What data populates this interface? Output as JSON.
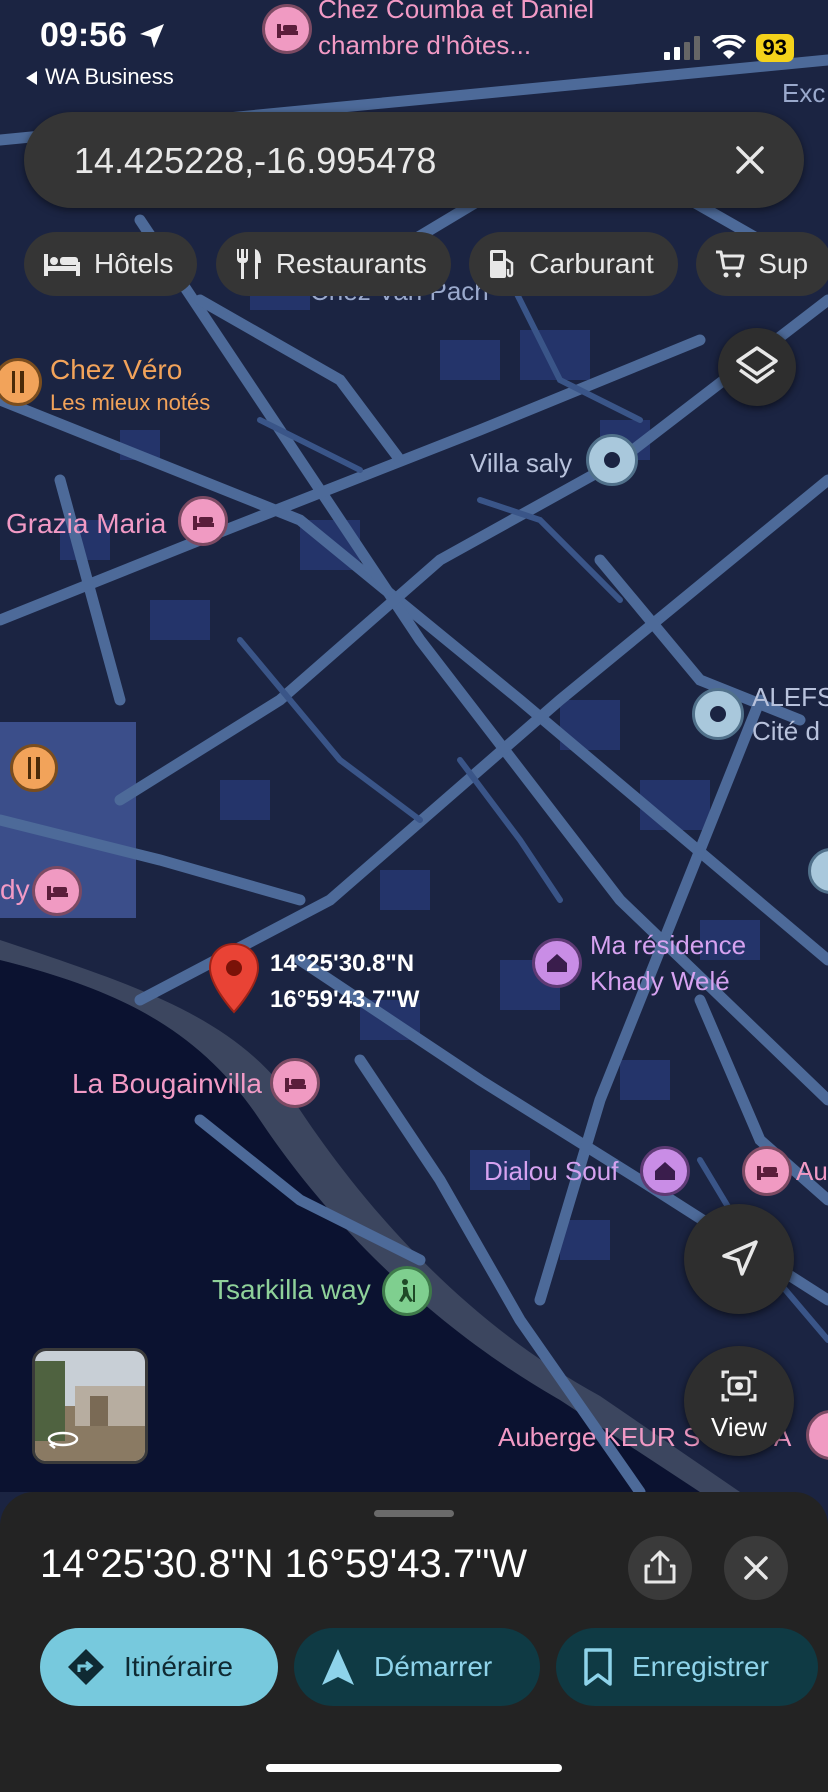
{
  "status_bar": {
    "time": "09:56",
    "back_app": "WA Business",
    "battery": "93"
  },
  "search": {
    "query": "14.425228,-16.995478"
  },
  "chips": [
    {
      "label": "Hôtels",
      "icon": "bed-icon"
    },
    {
      "label": "Restaurants",
      "icon": "cutlery-icon"
    },
    {
      "label": "Carburant",
      "icon": "fuel-icon"
    },
    {
      "label": "Sup",
      "icon": "cart-icon"
    }
  ],
  "map": {
    "places": {
      "chez_coumba_1": "Chez Coumba et Daniel",
      "chez_coumba_2": "chambre d'hôtes...",
      "exc": "Exc",
      "chez_van": "Chez Van Pach",
      "chez_vero": "Chez Véro",
      "chez_vero_sub": "Les mieux notés",
      "villa_saly": "Villa saly",
      "grazia": "Grazia Maria",
      "alefs_1": "ALEFS",
      "alefs_2": "Cité d",
      "dy": "dy",
      "ma_res_1": "Ma résidence",
      "ma_res_2": "Khady Welé",
      "bougainvilla": "La Bougainvilla",
      "dialou": "Dialou Souf",
      "au": "Au",
      "tsarkilla": "Tsarkilla way",
      "auberge": "Auberge KEUR S",
      "auberge_end": "A"
    },
    "pin": {
      "lat": "14°25'30.8\"N",
      "lng": "16°59'43.7\"W"
    }
  },
  "view_button": "View",
  "sheet": {
    "coords": "14°25'30.8\"N 16°59'43.7\"W",
    "actions": {
      "directions": "Itinéraire",
      "start": "Démarrer",
      "save": "Enregistrer"
    }
  }
}
